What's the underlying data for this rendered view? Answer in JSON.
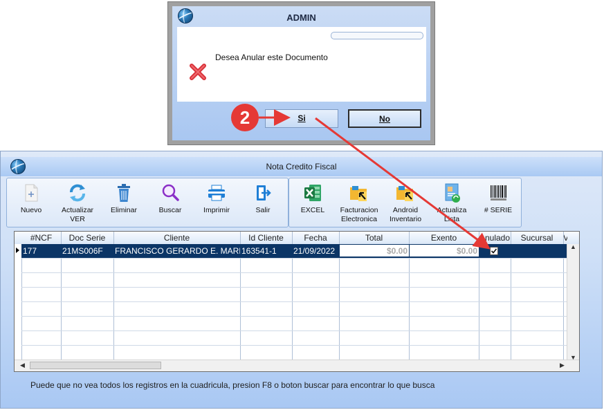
{
  "dialog": {
    "title": "ADMIN",
    "message": "Desea Anular este Documento",
    "yes_label": "Si",
    "no_label": "No"
  },
  "annotation": {
    "step_number": "2",
    "color": "#e53935"
  },
  "window": {
    "title": "Nota Credito Fiscal"
  },
  "toolbar_left": [
    {
      "label": "Nuevo",
      "icon": "new-document-icon"
    },
    {
      "label": "Actualizar\nVER",
      "icon": "refresh-icon"
    },
    {
      "label": "Eliminar",
      "icon": "trash-icon"
    },
    {
      "label": "Buscar",
      "icon": "magnifier-icon"
    },
    {
      "label": "Imprimir",
      "icon": "printer-icon"
    },
    {
      "label": "Salir",
      "icon": "exit-icon"
    }
  ],
  "toolbar_right": [
    {
      "label": "EXCEL",
      "icon": "excel-icon"
    },
    {
      "label": "Facturacion\nElectronica",
      "icon": "folder-arrow-icon"
    },
    {
      "label": "Android\nInventario",
      "icon": "folder-arrow-icon"
    },
    {
      "label": "Actualiza\nLista",
      "icon": "list-refresh-icon"
    },
    {
      "label": "# SERIE",
      "icon": "barcode-icon"
    }
  ],
  "grid": {
    "columns": [
      "#NCF",
      "Doc Serie",
      "Cliente",
      "Id Cliente",
      "Fecha",
      "Total",
      "Exento",
      "Anulado",
      "Sucursal",
      "V"
    ],
    "rows": [
      {
        "ncf": "177",
        "doc_serie": "21MS006F",
        "cliente": "FRANCISCO GERARDO E. MARM",
        "id_cliente": "163541-1",
        "fecha": "21/09/2022",
        "total": "$0.00",
        "exento": "$0.00",
        "anulado": true,
        "sucursal": ""
      }
    ]
  },
  "footer": {
    "message": "Puede que no vea todos los registros en la cuadricula, presion F8 o boton buscar para encontrar lo que busca"
  }
}
